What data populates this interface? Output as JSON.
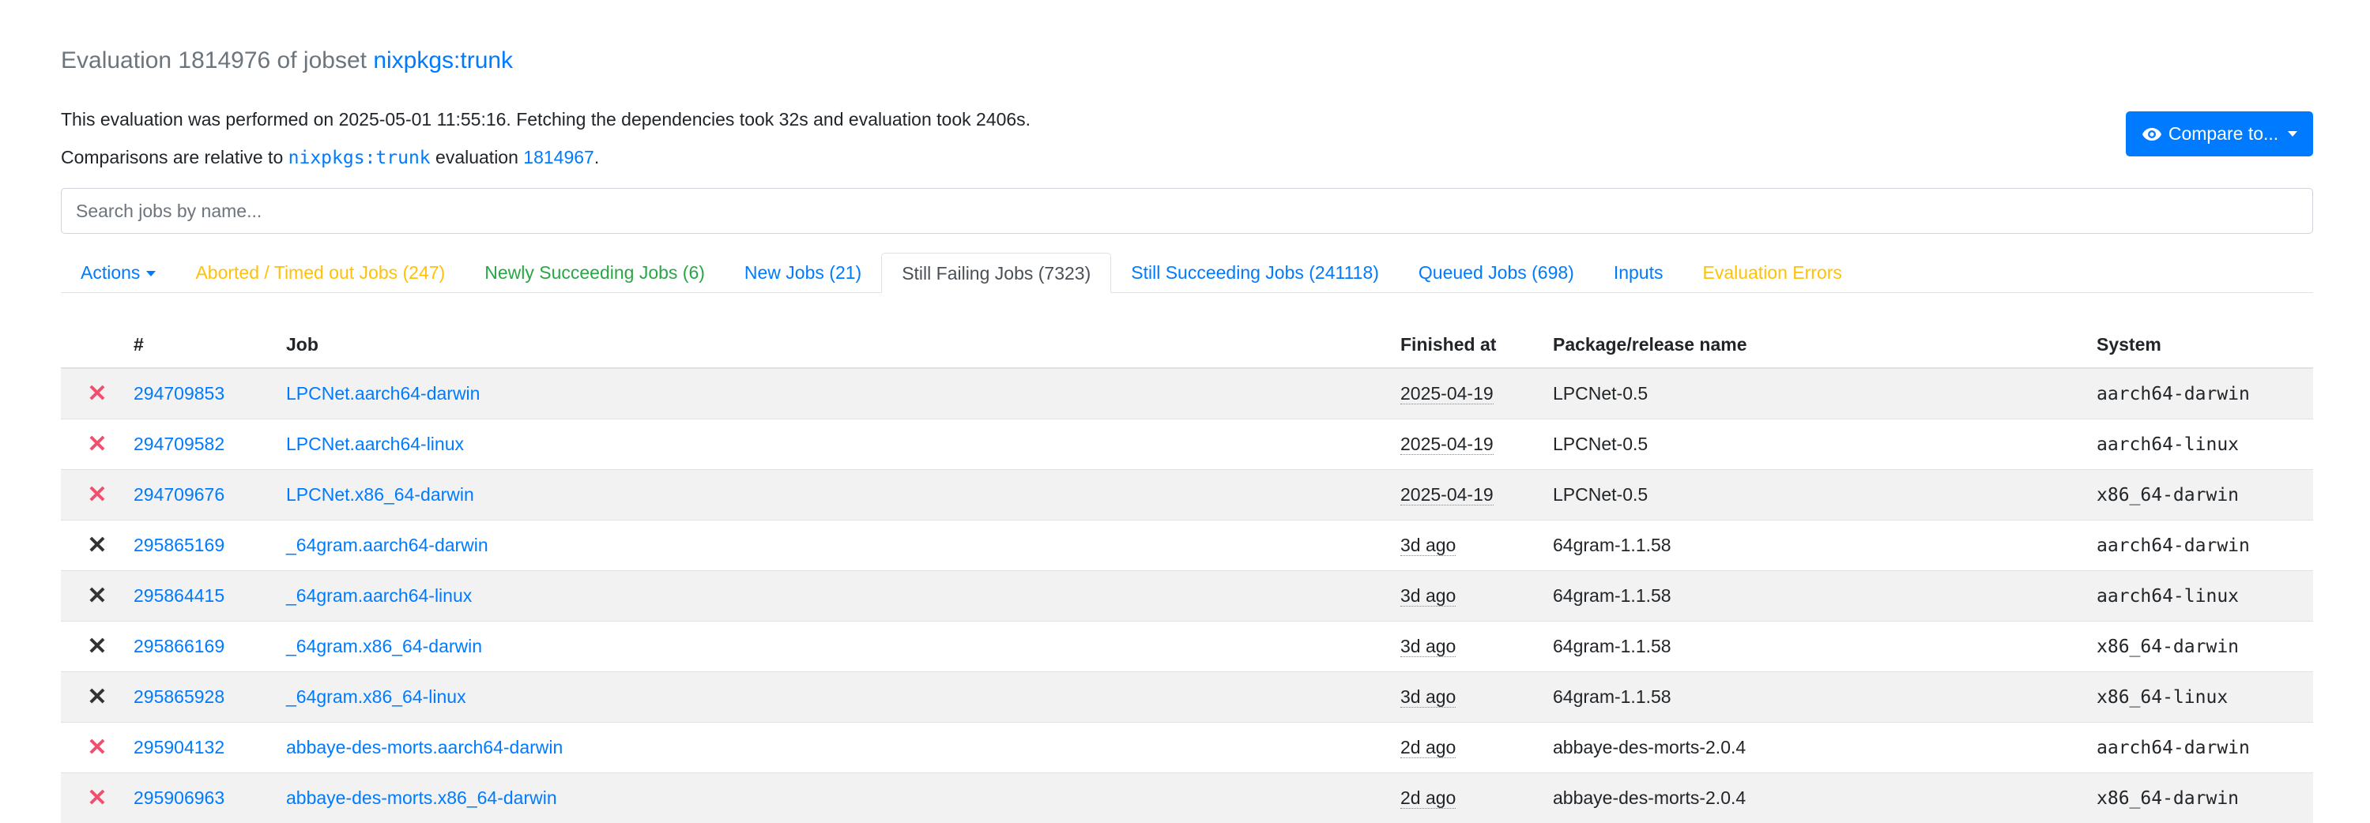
{
  "header": {
    "title_prefix": "Evaluation 1814976 of jobset",
    "title_link": "nixpkgs:trunk",
    "line1": "This evaluation was performed on 2025-05-01 11:55:16. Fetching the dependencies took 32s and evaluation took 2406s.",
    "line2_prefix": "Comparisons are relative to",
    "line2_jobset": "nixpkgs:trunk",
    "line2_mid": "evaluation",
    "line2_eval": "1814967",
    "line2_end": ".",
    "compare_label": "Compare to...",
    "compare_icon": "eye-icon"
  },
  "search": {
    "placeholder": "Search jobs by name..."
  },
  "tabs": [
    {
      "label": "Actions",
      "color": "#007bff"
    },
    {
      "label": "Aborted / Timed out Jobs (247)",
      "color": "#ffc107"
    },
    {
      "label": "Newly Succeeding Jobs (6)",
      "color": "#28a745"
    },
    {
      "label": "New Jobs (21)",
      "color": "#007bff"
    },
    {
      "label": "Still Failing Jobs (7323)",
      "color": "#495057"
    },
    {
      "label": "Still Succeeding Jobs (241118)",
      "color": "#007bff"
    },
    {
      "label": "Queued Jobs (698)",
      "color": "#007bff"
    },
    {
      "label": "Inputs",
      "color": "#007bff"
    },
    {
      "label": "Evaluation Errors",
      "color": "#ffc107"
    }
  ],
  "table": {
    "headers": [
      "#",
      "Job",
      "Finished at",
      "Package/release name",
      "System"
    ],
    "rows": [
      {
        "status": "failed-red",
        "id": "294709853",
        "job": "LPCNet.aarch64-darwin",
        "finished": "2025-04-19",
        "package": "LPCNet-0.5",
        "system": "aarch64-darwin"
      },
      {
        "status": "failed-red",
        "id": "294709582",
        "job": "LPCNet.aarch64-linux",
        "finished": "2025-04-19",
        "package": "LPCNet-0.5",
        "system": "aarch64-linux"
      },
      {
        "status": "failed-red",
        "id": "294709676",
        "job": "LPCNet.x86_64-darwin",
        "finished": "2025-04-19",
        "package": "LPCNet-0.5",
        "system": "x86_64-darwin"
      },
      {
        "status": "failed-dark",
        "id": "295865169",
        "job": "_64gram.aarch64-darwin",
        "finished": "3d ago",
        "package": "64gram-1.1.58",
        "system": "aarch64-darwin"
      },
      {
        "status": "failed-dark",
        "id": "295864415",
        "job": "_64gram.aarch64-linux",
        "finished": "3d ago",
        "package": "64gram-1.1.58",
        "system": "aarch64-linux"
      },
      {
        "status": "failed-dark",
        "id": "295866169",
        "job": "_64gram.x86_64-darwin",
        "finished": "3d ago",
        "package": "64gram-1.1.58",
        "system": "x86_64-darwin"
      },
      {
        "status": "failed-dark",
        "id": "295865928",
        "job": "_64gram.x86_64-linux",
        "finished": "3d ago",
        "package": "64gram-1.1.58",
        "system": "x86_64-linux"
      },
      {
        "status": "failed-red",
        "id": "295904132",
        "job": "abbaye-des-morts.aarch64-darwin",
        "finished": "2d ago",
        "package": "abbaye-des-morts-2.0.4",
        "system": "aarch64-darwin"
      },
      {
        "status": "failed-red",
        "id": "295906963",
        "job": "abbaye-des-morts.x86_64-darwin",
        "finished": "2d ago",
        "package": "abbaye-des-morts-2.0.4",
        "system": "x86_64-darwin"
      }
    ]
  }
}
